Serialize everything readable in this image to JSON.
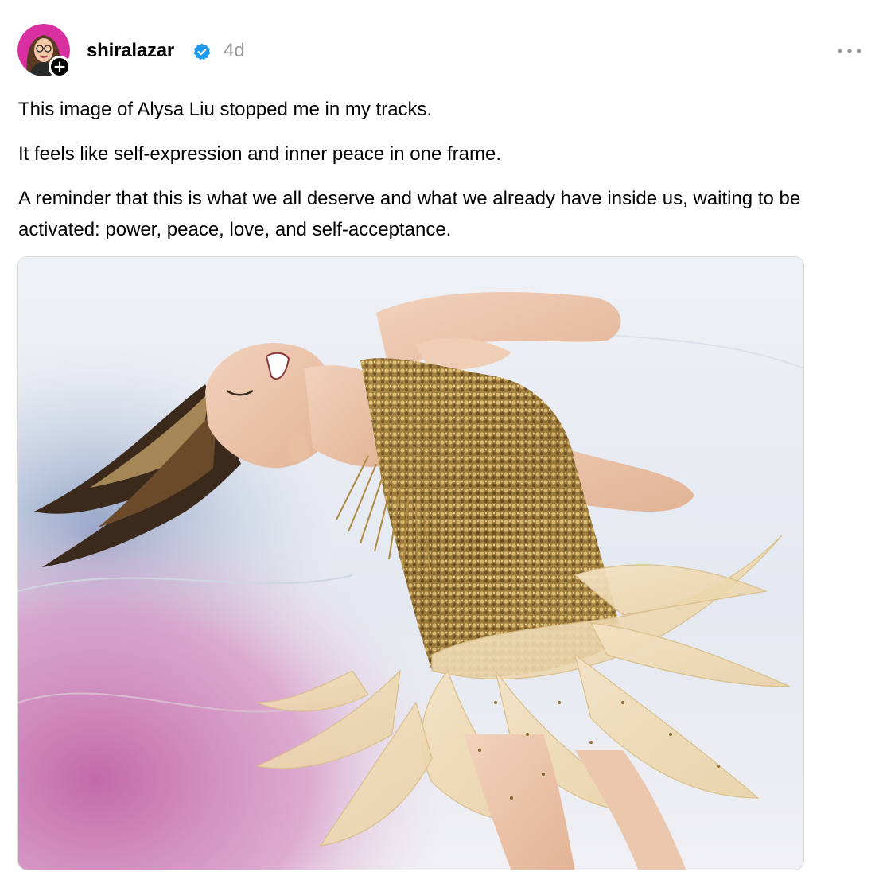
{
  "post": {
    "author": {
      "username": "shiralazar",
      "verified": true,
      "avatar_icon": "avatar-photo",
      "follow_icon": "plus-icon"
    },
    "timestamp": "4d",
    "more_icon": "more-horizontal-icon",
    "paragraphs": [
      "This image of Alysa Liu stopped me in my tracks.",
      "It feels like self-expression and inner peace in one frame.",
      "A reminder that this is what we all deserve and what we already have inside us, waiting to be activated: power, peace, love, and self-acceptance."
    ],
    "image": {
      "subject": "figure-skating-photo"
    }
  },
  "colors": {
    "verified_blue": "#1d9bf0",
    "timestamp_gray": "#999999",
    "avatar_ring": "#d92fa0",
    "badge_black": "#000000"
  }
}
